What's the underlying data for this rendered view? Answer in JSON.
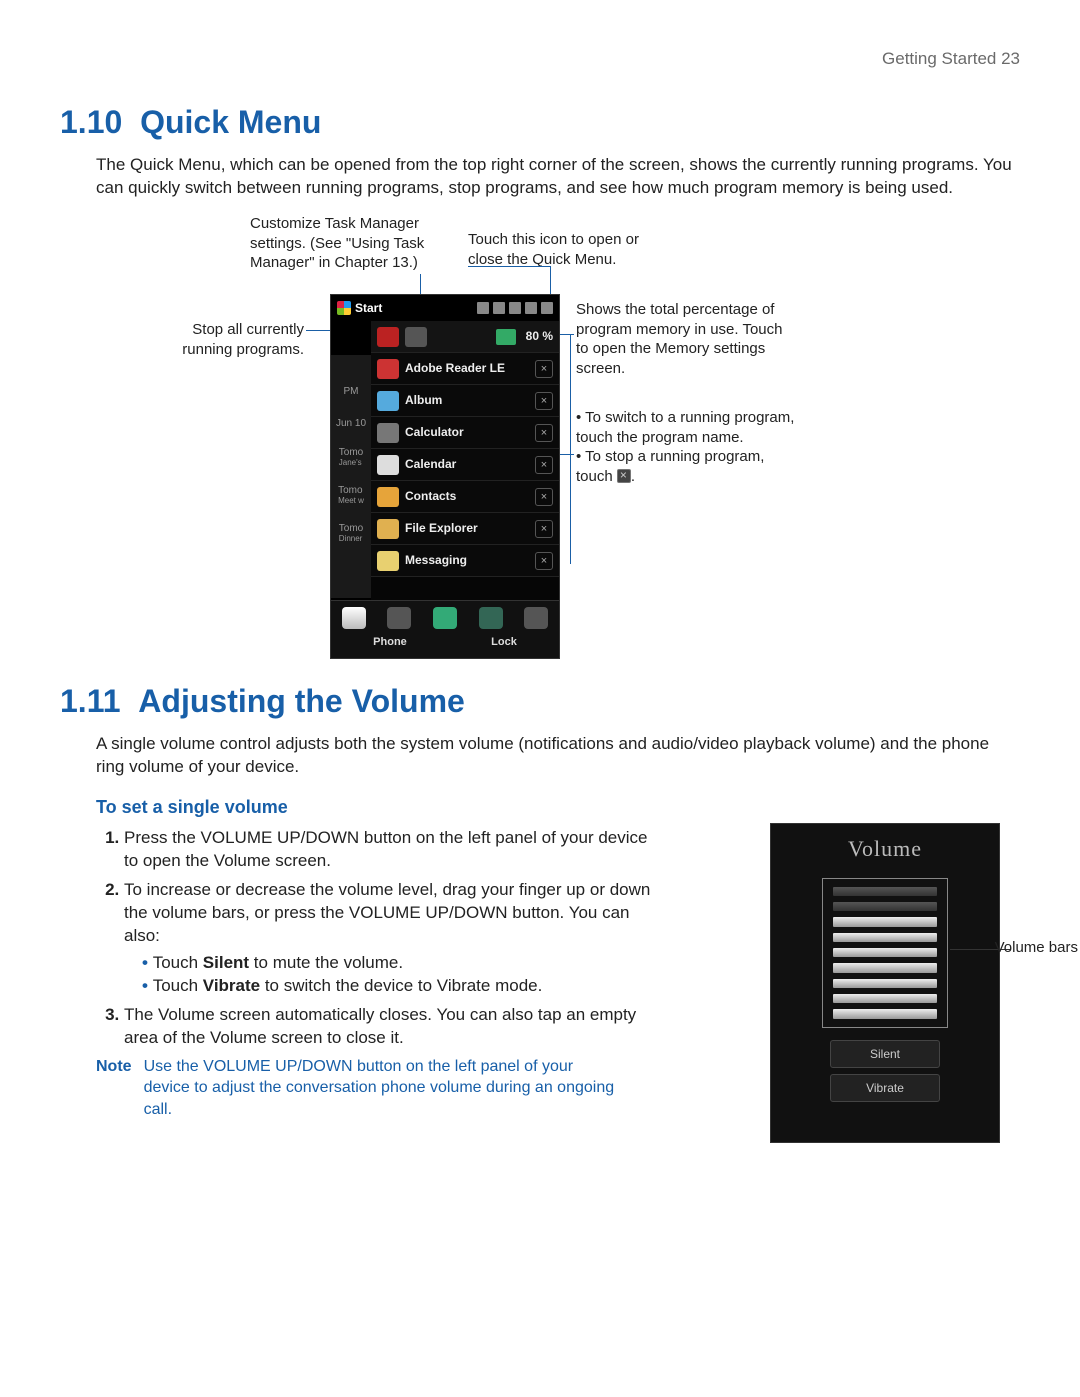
{
  "header": {
    "running": "Getting Started  23"
  },
  "s110": {
    "num": "1.10",
    "title": "Quick Menu",
    "intro": "The Quick Menu, which can be opened from the top right corner of the screen, shows the currently running programs. You can quickly switch between running programs, stop programs, and see how much program memory is being used."
  },
  "callouts": {
    "customize": "Customize Task Manager settings. (See \"Using Task Manager\" in Chapter 13.)",
    "open": "Touch this icon to open or close the Quick Menu.",
    "stopall": "Stop all currently running programs.",
    "memory": "Shows the total percentage of program memory in use. Touch to open the Memory settings screen.",
    "switch1": "To switch to a running program, touch the program name.",
    "switch2a": "To stop a running program, touch ",
    "switch2b": "."
  },
  "phone": {
    "start": "Start",
    "mem_pct": "80 %",
    "left": {
      "pm": "PM",
      "date": "Jun 10",
      "t1": "Tomo",
      "t1b": "Jane's",
      "t2": "Tomo",
      "t2b": "Meet w",
      "t3": "Tomo",
      "t3b": "Dinner"
    },
    "apps": [
      "Adobe Reader LE",
      "Album",
      "Calculator",
      "Calendar",
      "Contacts",
      "File Explorer",
      "Messaging"
    ],
    "bottom": {
      "phone": "Phone",
      "lock": "Lock"
    }
  },
  "s111": {
    "num": "1.11",
    "title": "Adjusting the Volume",
    "intro": "A single volume control adjusts both the system volume (notifications and audio/video playback volume) and the phone ring volume of your device.",
    "sub": "To set a single volume",
    "step1": "Press the VOLUME UP/DOWN button on the left panel of your device to open the Volume screen.",
    "step2": "To increase or decrease the volume level, drag your finger up or down the volume bars, or press the VOLUME UP/DOWN button. You can also:",
    "step2a_pre": "Touch ",
    "step2a_bold": "Silent",
    "step2a_post": " to mute the volume.",
    "step2b_pre": "Touch ",
    "step2b_bold": "Vibrate",
    "step2b_post": " to switch the device to Vibrate mode.",
    "step3": "The Volume screen automatically closes. You can also tap an empty area of the Volume screen to close it.",
    "note_label": "Note",
    "note": "Use the VOLUME UP/DOWN button on the left panel of your device to adjust the conversation phone volume during an ongoing call."
  },
  "volume": {
    "title": "Volume",
    "silent": "Silent",
    "vibrate": "Vibrate",
    "callout": "Volume bars"
  }
}
